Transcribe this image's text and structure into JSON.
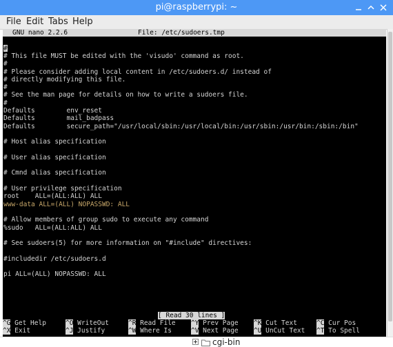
{
  "window": {
    "title": "pi@raspberrypi: ~"
  },
  "menu": [
    "File",
    "Edit",
    "Tabs",
    "Help"
  ],
  "nano": {
    "version": "GNU nano 2.2.6",
    "file": "File: /etc/sudoers.tmp",
    "status": "[ Read 30 lines ]",
    "lines": [
      "",
      "# This file MUST be edited with the 'visudo' command as root.",
      "#",
      "# Please consider adding local content in /etc/sudoers.d/ instead of",
      "# directly modifying this file.",
      "#",
      "# See the man page for details on how to write a sudoers file.",
      "#",
      "Defaults        env_reset",
      "Defaults        mail_badpass",
      "Defaults        secure_path=\"/usr/local/sbin:/usr/local/bin:/usr/sbin:/usr/bin:/sbin:/bin\"",
      "",
      "# Host alias specification",
      "",
      "# User alias specification",
      "",
      "# Cmnd alias specification",
      "",
      "# User privilege specification",
      "root    ALL=(ALL:ALL) ALL",
      "www-data ALL=(ALL) NOPASSWD: ALL",
      "",
      "# Allow members of group sudo to execute any command",
      "%sudo   ALL=(ALL:ALL) ALL",
      "",
      "# See sudoers(5) for more information on \"#include\" directives:",
      "",
      "#includedir /etc/sudoers.d",
      "",
      "pi ALL=(ALL) NOPASSWD: ALL"
    ],
    "cursor_char": "#",
    "shortcuts_row1": [
      {
        "key": "^G",
        "label": "Get Help"
      },
      {
        "key": "^O",
        "label": "WriteOut"
      },
      {
        "key": "^R",
        "label": "Read File"
      },
      {
        "key": "^Y",
        "label": "Prev Page"
      },
      {
        "key": "^K",
        "label": "Cut Text"
      },
      {
        "key": "^C",
        "label": "Cur Pos"
      }
    ],
    "shortcuts_row2": [
      {
        "key": "^X",
        "label": "Exit"
      },
      {
        "key": "^J",
        "label": "Justify"
      },
      {
        "key": "^W",
        "label": "Where Is"
      },
      {
        "key": "^V",
        "label": "Next Page"
      },
      {
        "key": "^U",
        "label": "UnCut Text"
      },
      {
        "key": "^T",
        "label": "To Spell"
      }
    ]
  },
  "footer": {
    "folder_label": "cgi-bin"
  },
  "colors": {
    "titlebar": "#4d98f5",
    "terminal_bg": "#000000",
    "text": "#d6d6d6",
    "highlight": "#d8d8d8",
    "warning_line": "#c8a86a"
  }
}
